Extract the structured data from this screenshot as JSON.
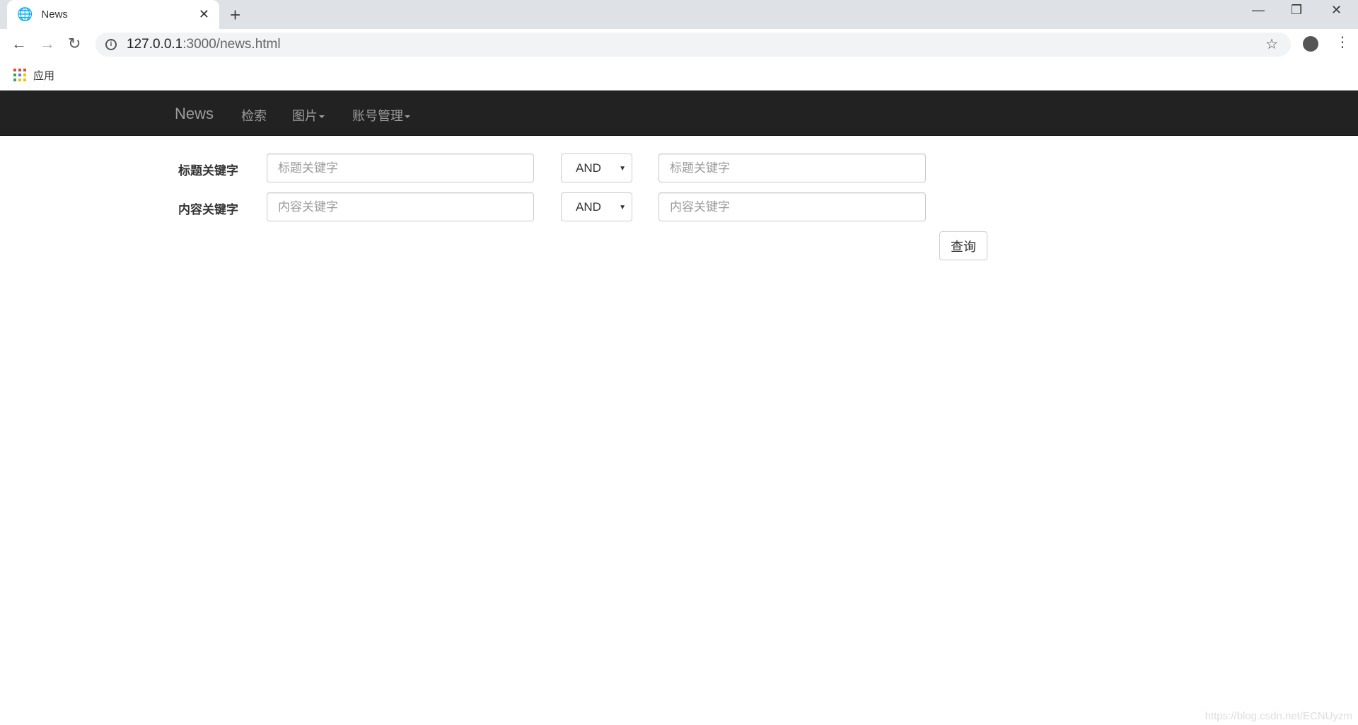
{
  "browser": {
    "tab_title": "News",
    "url_host": "127.0.0.1",
    "url_rest": ":3000/news.html",
    "bookmark": "应用"
  },
  "navbar": {
    "brand": "News",
    "items": [
      {
        "label": "检索"
      },
      {
        "label": "图片"
      },
      {
        "label": "账号管理"
      }
    ]
  },
  "form": {
    "rows": [
      {
        "label": "标题关键字",
        "placeholder1": "标题关键字",
        "operator": "AND",
        "placeholder2": "标题关键字"
      },
      {
        "label": "内容关键字",
        "placeholder1": "内容关键字",
        "operator": "AND",
        "placeholder2": "内容关键字"
      }
    ],
    "submit": "查询"
  },
  "watermark": "https://blog.csdn.net/ECNUyzm"
}
